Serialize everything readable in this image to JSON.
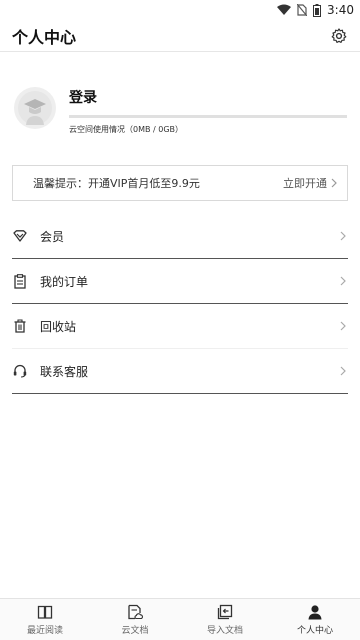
{
  "status": {
    "time": "3:40"
  },
  "header": {
    "title": "个人中心",
    "settings_icon": "gear-icon"
  },
  "profile": {
    "login_label": "登录",
    "storage_text": "云空间使用情况（0MB / 0GB）",
    "storage_used_fraction": 0
  },
  "vip": {
    "tip_text": "温馨提示：开通VIP首月低至9.9元",
    "action_label": "立即开通"
  },
  "menu": {
    "items": [
      {
        "label": "会员",
        "icon": "vip-diamond-icon"
      },
      {
        "label": "我的订单",
        "icon": "clipboard-icon"
      },
      {
        "label": "回收站",
        "icon": "trash-icon"
      },
      {
        "label": "联系客服",
        "icon": "headset-icon"
      }
    ]
  },
  "nav": {
    "items": [
      {
        "label": "最近阅读",
        "icon": "book-icon"
      },
      {
        "label": "云文档",
        "icon": "cloud-doc-icon"
      },
      {
        "label": "导入文档",
        "icon": "import-icon"
      },
      {
        "label": "个人中心",
        "icon": "person-icon",
        "active": true
      }
    ]
  },
  "colors": {
    "text": "#222222",
    "divider": "#e6e6e6",
    "accent": "#333333"
  }
}
